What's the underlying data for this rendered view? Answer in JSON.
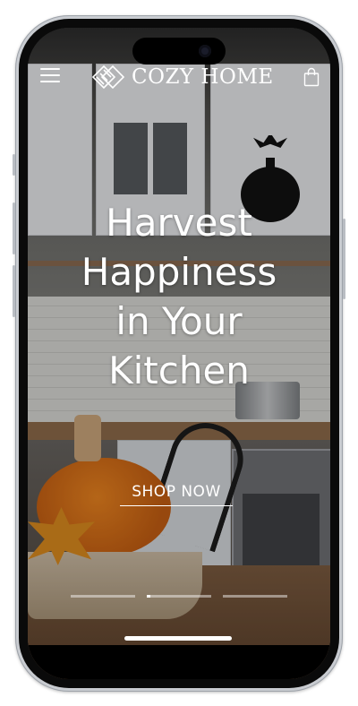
{
  "brand": {
    "name": "COZY HOME",
    "logo_icon": "diamond-stripes-logo-icon"
  },
  "header": {
    "menu_icon": "hamburger-menu-icon",
    "cart_icon": "shopping-bag-icon"
  },
  "hero": {
    "headline_lines": [
      "Harvest",
      "Happiness",
      "in Your",
      "Kitchen"
    ],
    "cta_label": "SHOP NOW"
  },
  "slider": {
    "slides": [
      {
        "progress": 0.0
      },
      {
        "progress": 0.05
      },
      {
        "progress": 0.0
      }
    ]
  },
  "colors": {
    "text": "#ffffff",
    "frame": "#c9ccd1",
    "bezel": "#0a0a0a"
  }
}
